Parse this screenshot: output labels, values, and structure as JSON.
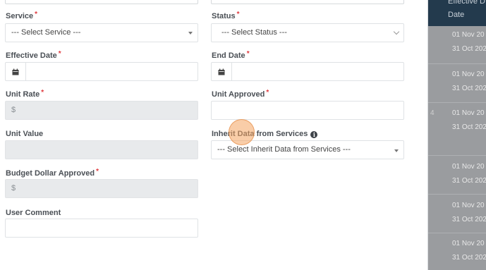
{
  "form": {
    "service": {
      "label": "Service",
      "required_mark": "*",
      "value": "--- Select Service ---"
    },
    "status": {
      "label": "Status",
      "required_mark": "*",
      "value": "--- Select Status ---"
    },
    "effective_date": {
      "label": "Effective Date",
      "required_mark": "*",
      "value": ""
    },
    "end_date": {
      "label": "End Date",
      "required_mark": "*",
      "value": ""
    },
    "unit_rate": {
      "label": "Unit Rate",
      "required_mark": "*",
      "prefix": "$"
    },
    "unit_approved": {
      "label": "Unit Approved",
      "required_mark": "*",
      "value": ""
    },
    "unit_value": {
      "label": "Unit Value",
      "value": ""
    },
    "inherit_data": {
      "label": "Inherit Data from Services",
      "info_icon": "info-icon",
      "value": "--- Select Inherit Data from Services ---"
    },
    "budget_dollar_approved": {
      "label": "Budget Dollar Approved",
      "required_mark": "*",
      "prefix": "$"
    },
    "user_comment": {
      "label": "User Comment",
      "value": ""
    }
  },
  "background_table": {
    "header_top": "Effective D",
    "header_bottom": "Date",
    "row_marker": "4",
    "rows": [
      {
        "line1": "01 Nov 20",
        "line2": "31 Oct 202"
      },
      {
        "line1": "01 Nov 20",
        "line2": "31 Oct 202"
      },
      {
        "line1": "01 Nov 20",
        "line2": "31 Oct 202"
      },
      {
        "line1": "01 Nov 20",
        "line2": "31 Oct 202"
      },
      {
        "line1": "01 Nov 20",
        "line2": "31 Oct 202"
      },
      {
        "line1": "01 Nov 20",
        "line2": "31 Oct 202"
      }
    ]
  },
  "colors": {
    "required": "#e0393e",
    "table_header": "#233a4d",
    "cursor_highlight": "#f4a460"
  }
}
